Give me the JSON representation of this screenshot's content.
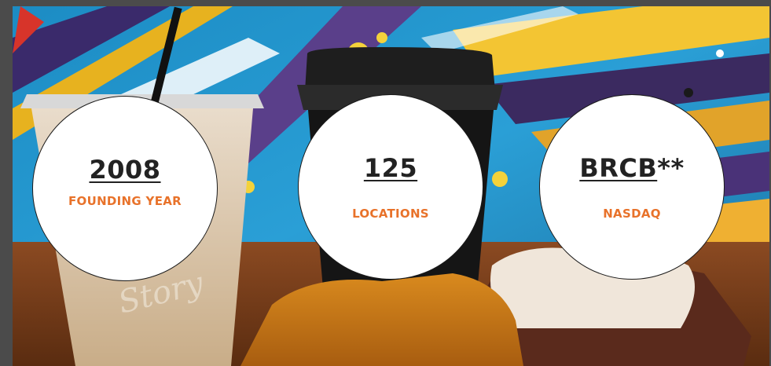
{
  "stats": [
    {
      "value": "2008",
      "suffix": "",
      "label": "FOUNDING YEAR"
    },
    {
      "value": "125",
      "suffix": "",
      "label": "LOCATIONS"
    },
    {
      "value": "BRCB",
      "suffix": "**",
      "label": "NASDAQ"
    }
  ],
  "photo": {
    "cup_print": "Story"
  },
  "colors": {
    "label_accent": "#e8722a",
    "value_text": "#222222",
    "circle_bg": "#ffffff",
    "page_bg": "#4b4b4b"
  }
}
